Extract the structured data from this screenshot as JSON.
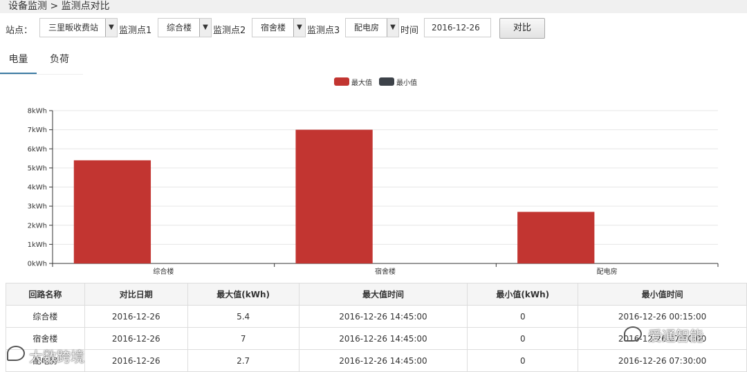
{
  "breadcrumb": "设备监测 > 监测点对比",
  "filters": {
    "station_label": "站点：",
    "station_value": "三里畈收费站",
    "point1_label": "监测点1",
    "point1_value": "综合楼",
    "point2_label": "监测点2",
    "point2_value": "宿舍楼",
    "point3_label": "监测点3",
    "point3_value": "配电房",
    "time_label": "时间",
    "date_value": "2016-12-26",
    "compare_button": "对比"
  },
  "tabs": [
    {
      "label": "电量",
      "active": true
    },
    {
      "label": "负荷",
      "active": false
    }
  ],
  "colors": {
    "max": "#c23531",
    "min": "#3d4249",
    "tab_accent": "#3a7aa2"
  },
  "chart_data": {
    "type": "bar",
    "categories": [
      "综合楼",
      "宿舍楼",
      "配电房"
    ],
    "series": [
      {
        "name": "最大值",
        "values": [
          5.4,
          7,
          2.7
        ]
      },
      {
        "name": "最小值",
        "values": [
          0,
          0,
          0
        ]
      }
    ],
    "y_ticks": [
      "0kWh",
      "1kWh",
      "2kWh",
      "3kWh",
      "4kWh",
      "5kWh",
      "6kWh",
      "7kWh",
      "8kWh"
    ],
    "ylim": [
      0,
      8
    ],
    "grid": true,
    "legend_position": "top-center"
  },
  "table": {
    "headers": [
      "回路名称",
      "对比日期",
      "最大值(kWh)",
      "最大值时间",
      "最小值(kWh)",
      "最小值时间"
    ],
    "rows": [
      [
        "综合楼",
        "2016-12-26",
        "5.4",
        "2016-12-26 14:45:00",
        "0",
        "2016-12-26 00:15:00"
      ],
      [
        "宿舍楼",
        "2016-12-26",
        "7",
        "2016-12-26 14:45:00",
        "0",
        "2016-12-26 07:30:00"
      ],
      [
        "配电房",
        "2016-12-26",
        "2.7",
        "2016-12-26 14:45:00",
        "0",
        "2016-12-26 07:30:00"
      ]
    ]
  },
  "watermarks": {
    "left": "大数跨境",
    "right": "爱通智能"
  }
}
